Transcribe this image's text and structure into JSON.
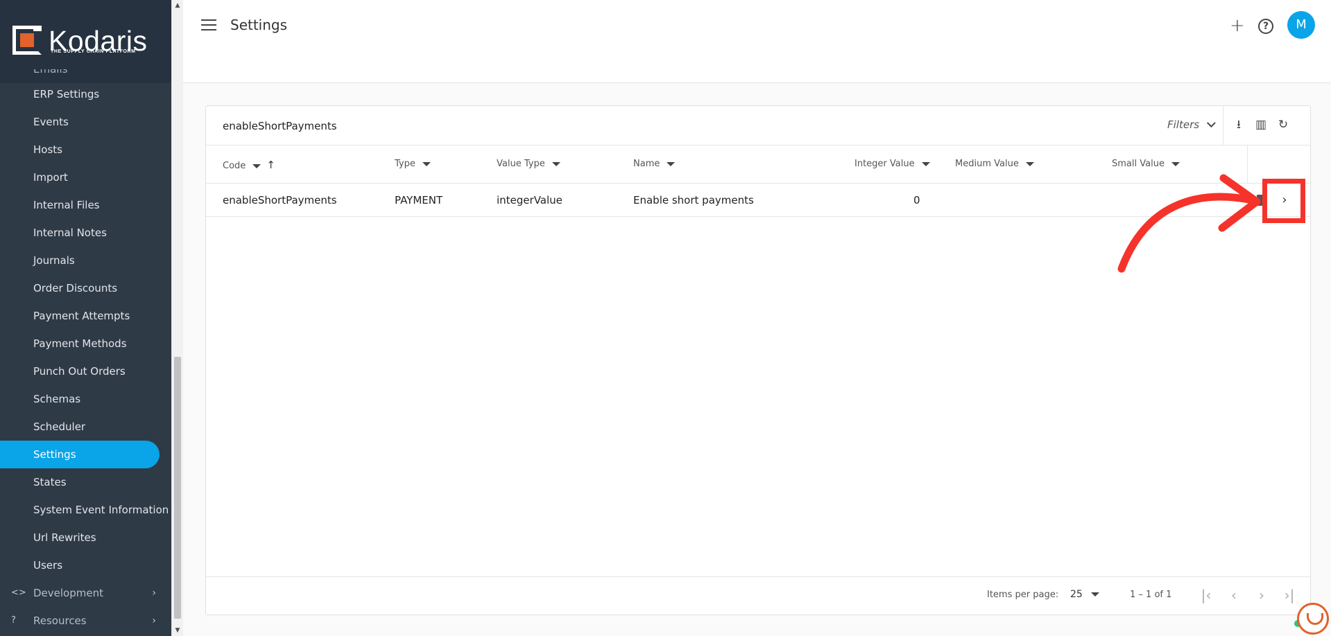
{
  "brand": {
    "name": "Kodaris",
    "tagline": "THE SUPPLY CHAIN PLATFORM",
    "logo_color": "#e1622b"
  },
  "header": {
    "title": "Settings",
    "avatar_initial": "M"
  },
  "sidebar": {
    "cut_item": "Emails",
    "items": [
      {
        "label": "ERP Settings"
      },
      {
        "label": "Events"
      },
      {
        "label": "Hosts"
      },
      {
        "label": "Import"
      },
      {
        "label": "Internal Files"
      },
      {
        "label": "Internal Notes"
      },
      {
        "label": "Journals"
      },
      {
        "label": "Order Discounts"
      },
      {
        "label": "Payment Attempts"
      },
      {
        "label": "Payment Methods"
      },
      {
        "label": "Punch Out Orders"
      },
      {
        "label": "Schemas"
      },
      {
        "label": "Scheduler"
      },
      {
        "label": "Settings"
      },
      {
        "label": "States"
      },
      {
        "label": "System Event Information"
      },
      {
        "label": "Url Rewrites"
      },
      {
        "label": "Users"
      }
    ],
    "sections": [
      {
        "label": "Development",
        "icon": "code-icon"
      },
      {
        "label": "Resources",
        "icon": "help-circle-icon"
      }
    ],
    "active_color": "#0aa4e8"
  },
  "toolbar": {
    "search_value": "enableShortPayments",
    "filters_label": "Filters"
  },
  "table": {
    "columns": [
      "Code",
      "Type",
      "Value Type",
      "Name",
      "Integer Value",
      "Medium Value",
      "Small Value"
    ],
    "rows": [
      {
        "code": "enableShortPayments",
        "type": "PAYMENT",
        "value_type": "integerValue",
        "name": "Enable short payments",
        "integer_value": "0",
        "medium_value": "",
        "small_value": ""
      }
    ]
  },
  "pagination": {
    "items_per_page_label": "Items per page:",
    "items_per_page": "25",
    "range": "1 – 1 of 1"
  },
  "annotation": {
    "color": "#f5332b"
  }
}
